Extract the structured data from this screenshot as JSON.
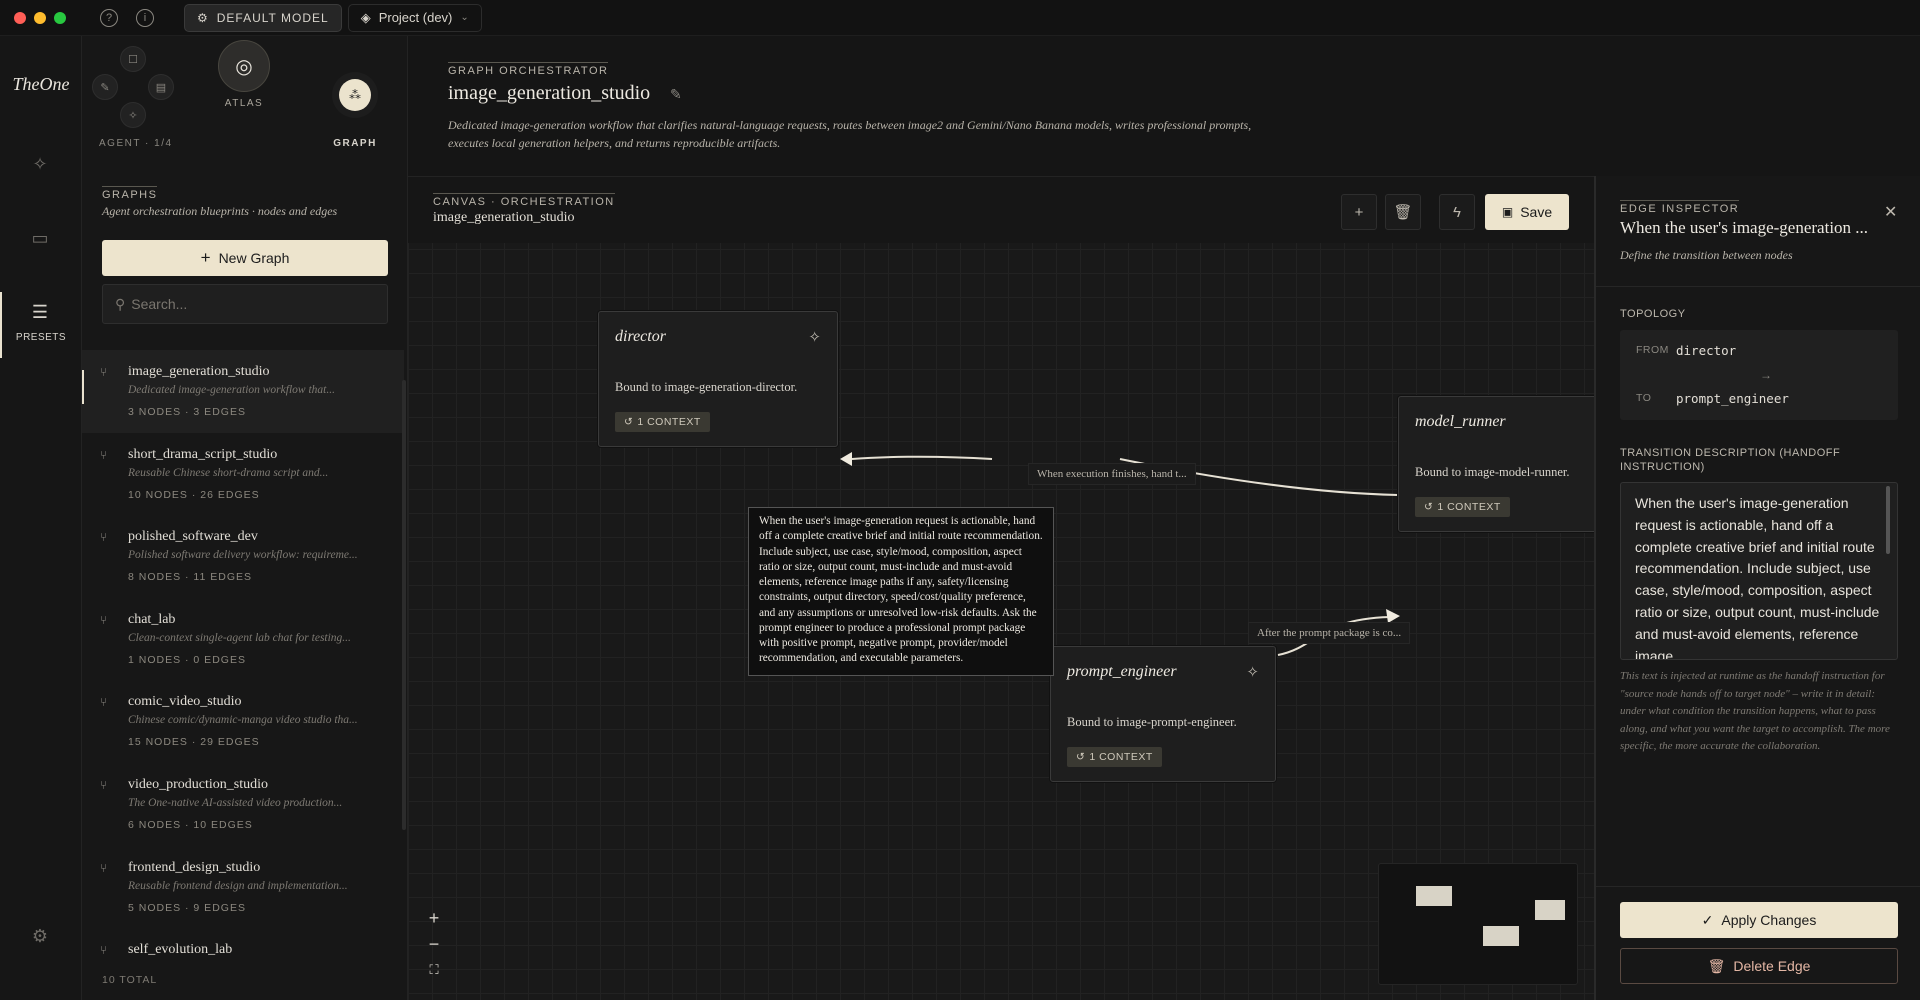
{
  "titlebar": {
    "model_label": "DEFAULT MODEL",
    "project_label": "Project (dev)"
  },
  "rail": {
    "brand": "TheOne",
    "active_label": "PRESETS"
  },
  "sidebar": {
    "agent_label": "AGENT · 1/4",
    "atlas_label": "ATLAS",
    "graph_label": "GRAPH",
    "section_title": "GRAPHS",
    "section_sub": "Agent orchestration blueprints · nodes and edges",
    "new_graph_label": "New Graph",
    "search_placeholder": "Search...",
    "items": [
      {
        "name": "image_generation_studio",
        "desc": "Dedicated image-generation workflow that...",
        "meta": "3 NODES · 3 EDGES"
      },
      {
        "name": "short_drama_script_studio",
        "desc": "Reusable Chinese short-drama script and...",
        "meta": "10 NODES · 26 EDGES"
      },
      {
        "name": "polished_software_dev",
        "desc": "Polished software delivery workflow: requireme...",
        "meta": "8 NODES · 11 EDGES"
      },
      {
        "name": "chat_lab",
        "desc": "Clean-context single-agent lab chat for testing...",
        "meta": "1 NODES · 0 EDGES"
      },
      {
        "name": "comic_video_studio",
        "desc": "Chinese comic/dynamic-manga video studio tha...",
        "meta": "15 NODES · 29 EDGES"
      },
      {
        "name": "video_production_studio",
        "desc": "The One-native AI-assisted video production...",
        "meta": "6 NODES · 10 EDGES"
      },
      {
        "name": "frontend_design_studio",
        "desc": "Reusable frontend design and implementation...",
        "meta": "5 NODES · 9 EDGES"
      },
      {
        "name": "self_evolution_lab",
        "desc": "",
        "meta": ""
      }
    ],
    "total": "10 TOTAL"
  },
  "header": {
    "kicker": "GRAPH ORCHESTRATOR",
    "title": "image_generation_studio",
    "description": "Dedicated image-generation workflow that clarifies natural-language requests, routes between image2 and Gemini/Nano Banana models, writes professional prompts, executes local generation helpers, and returns reproducible artifacts."
  },
  "canvas": {
    "kicker": "CANVAS · ORCHESTRATION",
    "title": "image_generation_studio",
    "save_label": "Save",
    "nodes": {
      "director": {
        "title": "director",
        "desc": "Bound to image-generation-director.",
        "badge": "1 CONTEXT"
      },
      "model_runner": {
        "title": "model_runner",
        "desc": "Bound to image-model-runner.",
        "badge": "1 CONTEXT"
      },
      "prompt_engineer": {
        "title": "prompt_engineer",
        "desc": "Bound to image-prompt-engineer.",
        "badge": "1 CONTEXT"
      }
    },
    "edge_labels": {
      "runner_to_director": "When execution finishes, hand t...",
      "prompt_to_runner": "After the prompt package is co..."
    },
    "tooltip": "When the user's image-generation request is actionable, hand off a complete creative brief and initial route recommendation. Include subject, use case, style/mood, composition, aspect ratio or size, output count, must-include and must-avoid elements, reference image paths if any, safety/licensing constraints, output directory, speed/cost/quality preference, and any assumptions or unresolved low-risk defaults. Ask the prompt engineer to produce a professional prompt package with positive prompt, negative prompt, provider/model recommendation, and executable parameters."
  },
  "inspector": {
    "kicker": "EDGE INSPECTOR",
    "title": "When the user's image-generation ...",
    "sub": "Define the transition between nodes",
    "topology_label": "TOPOLOGY",
    "from_key": "FROM",
    "from_value": "director",
    "to_key": "TO",
    "to_value": "prompt_engineer",
    "desc_label": "TRANSITION DESCRIPTION (HANDOFF INSTRUCTION)",
    "desc_text": "When the user's image-generation request is actionable, hand off a complete creative brief and initial route recommendation. Include subject, use case, style/mood, composition, aspect ratio or size, output count, must-include and must-avoid elements, reference image",
    "help": "This text is injected at runtime as the handoff instruction for \"source node hands off to target node\" – write it in detail: under what condition the transition happens, what to pass along, and what you want the target to accomplish. The more specific, the more accurate the collaboration.",
    "apply_label": "Apply Changes",
    "delete_label": "Delete Edge"
  }
}
